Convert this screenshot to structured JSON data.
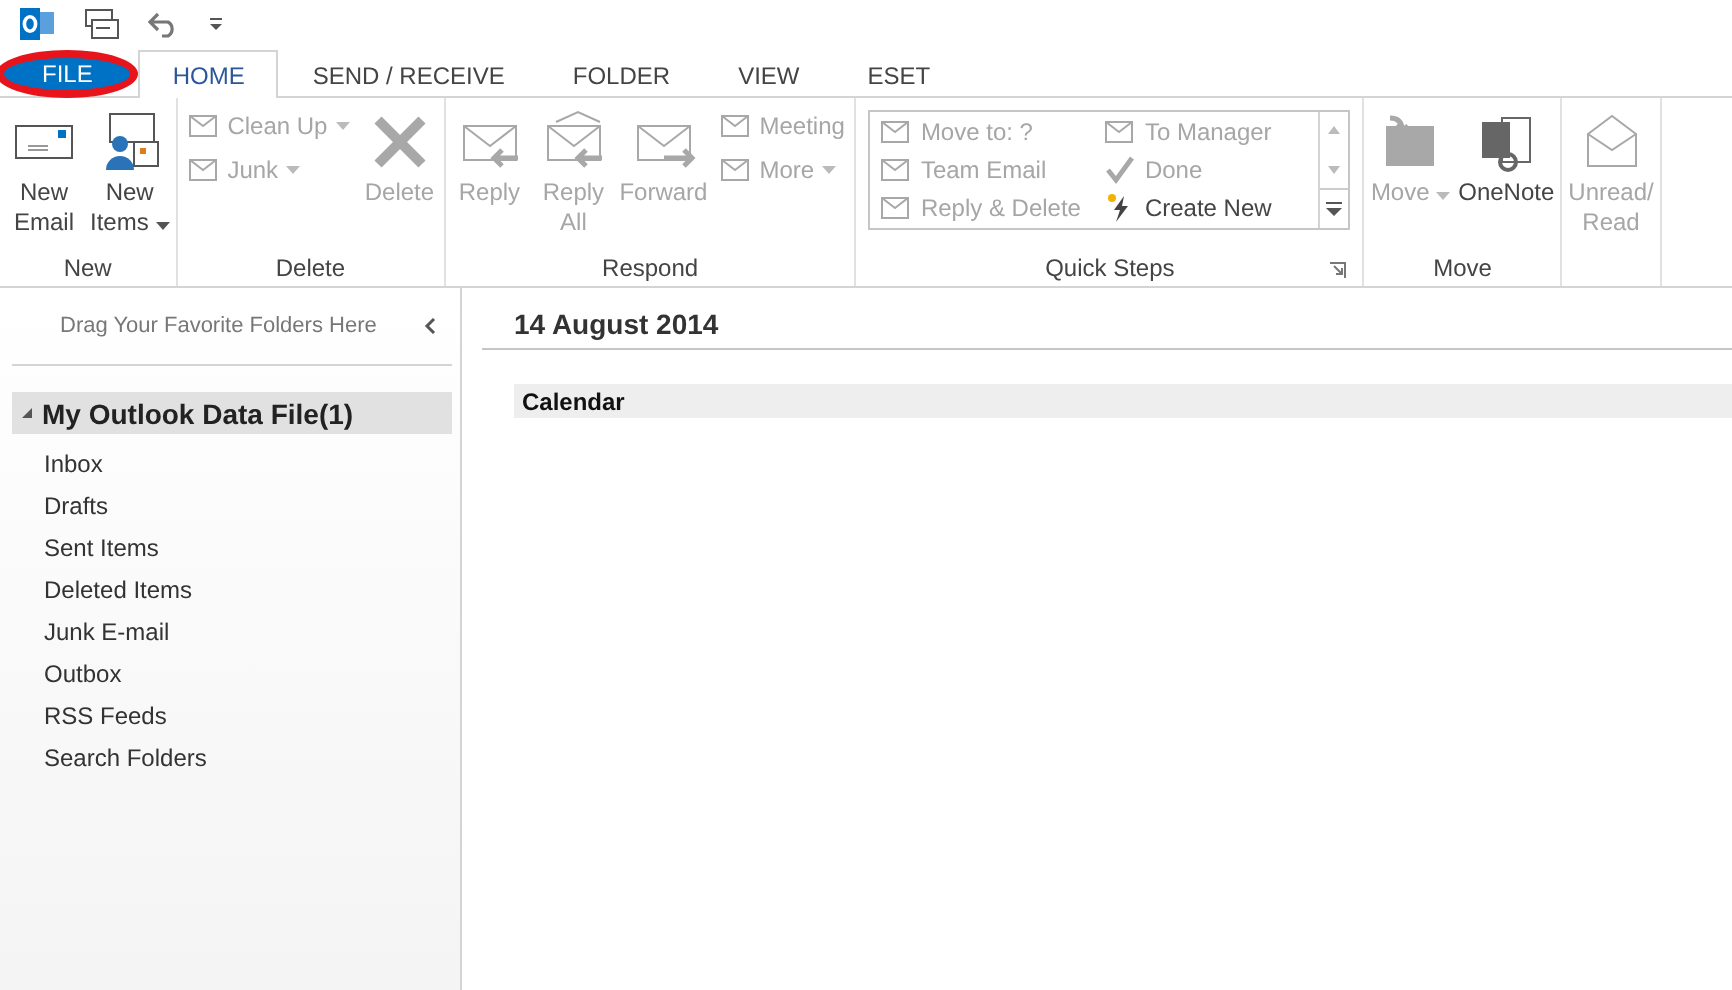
{
  "tabs": [
    {
      "label": "FILE",
      "kind": "file",
      "selected": false,
      "circled": true
    },
    {
      "label": "HOME",
      "kind": "tab",
      "selected": true,
      "circled": false
    },
    {
      "label": "SEND / RECEIVE",
      "kind": "tab",
      "selected": false,
      "circled": false
    },
    {
      "label": "FOLDER",
      "kind": "tab",
      "selected": false,
      "circled": false
    },
    {
      "label": "VIEW",
      "kind": "tab",
      "selected": false,
      "circled": false
    },
    {
      "label": "ESET",
      "kind": "tab",
      "selected": false,
      "circled": false
    }
  ],
  "ribbon": {
    "groups": [
      {
        "label": "New",
        "kind": "buttons",
        "launcher": false,
        "columns": [
          [
            {
              "kind": "large",
              "label": "New\nEmail",
              "disabled": false,
              "dropdown": false
            }
          ],
          [
            {
              "kind": "large",
              "label": "New\nItems",
              "disabled": false,
              "dropdown": true
            }
          ]
        ]
      },
      {
        "label": "Delete",
        "kind": "buttons",
        "launcher": false,
        "columns": [
          [
            {
              "kind": "small",
              "label": "Clean Up",
              "disabled": true,
              "dropdown": true
            },
            {
              "kind": "small",
              "label": "Junk",
              "disabled": true,
              "dropdown": true
            }
          ],
          [
            {
              "kind": "large",
              "label": "Delete",
              "disabled": true,
              "dropdown": false
            }
          ]
        ]
      },
      {
        "label": "Respond",
        "kind": "buttons",
        "launcher": false,
        "columns": [
          [
            {
              "kind": "large",
              "label": "Reply",
              "disabled": true,
              "dropdown": false
            }
          ],
          [
            {
              "kind": "large",
              "label": "Reply\nAll",
              "disabled": true,
              "dropdown": false
            }
          ],
          [
            {
              "kind": "large",
              "label": "Forward",
              "disabled": true,
              "dropdown": false
            }
          ],
          [
            {
              "kind": "small",
              "label": "Meeting",
              "disabled": true,
              "dropdown": false
            },
            {
              "kind": "small",
              "label": "More",
              "disabled": true,
              "dropdown": true
            }
          ]
        ]
      },
      {
        "label": "Quick Steps",
        "kind": "gallery",
        "launcher": true,
        "columns": [
          [
            {
              "kind": "small",
              "label": "Move to: ?",
              "disabled": true,
              "dropdown": false
            },
            {
              "kind": "small",
              "label": "Team Email",
              "disabled": true,
              "dropdown": false
            },
            {
              "kind": "small",
              "label": "Reply & Delete",
              "disabled": true,
              "dropdown": false
            }
          ],
          [
            {
              "kind": "small",
              "label": "To Manager",
              "disabled": true,
              "dropdown": false
            },
            {
              "kind": "small",
              "label": "Done",
              "disabled": true,
              "dropdown": false
            },
            {
              "kind": "small",
              "label": "Create New",
              "disabled": false,
              "dropdown": false
            }
          ]
        ]
      },
      {
        "label": "Move",
        "kind": "buttons",
        "launcher": false,
        "columns": [
          [
            {
              "kind": "large",
              "label": "Move",
              "disabled": true,
              "dropdown": true
            }
          ],
          [
            {
              "kind": "large",
              "label": "OneNote",
              "disabled": false,
              "dropdown": false
            }
          ]
        ]
      },
      {
        "kind": "buttons",
        "launcher": false,
        "columns": [
          [
            {
              "kind": "large",
              "label": "Unread/\nRead",
              "disabled": true,
              "dropdown": false
            }
          ]
        ]
      }
    ]
  },
  "sidebar": {
    "favorites_hint": "Drag Your Favorite Folders Here",
    "tree": [
      {
        "label": "My Outlook Data File(1)",
        "expanded": true,
        "children": [
          {
            "label": "Inbox"
          },
          {
            "label": "Drafts"
          },
          {
            "label": "Sent Items"
          },
          {
            "label": "Deleted Items"
          },
          {
            "label": "Junk E-mail"
          },
          {
            "label": "Outbox"
          },
          {
            "label": "RSS Feeds"
          },
          {
            "label": "Search Folders"
          }
        ]
      }
    ]
  },
  "main": {
    "date": "14 August 2014",
    "section": "Calendar"
  }
}
